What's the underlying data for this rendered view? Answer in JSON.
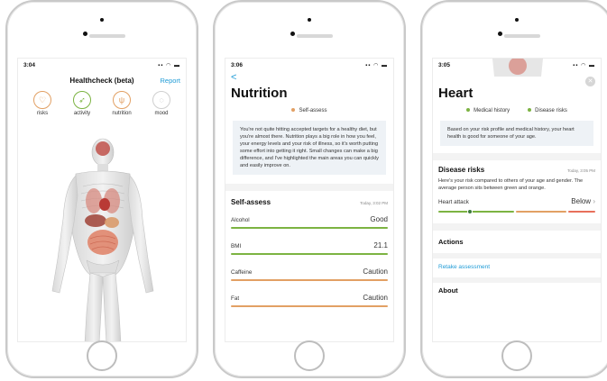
{
  "colors": {
    "accent": "#1f9bd6",
    "good": "#7cb342",
    "caution": "#e2a064",
    "risk": "#e8705b"
  },
  "phone1": {
    "status_time": "3:04",
    "title": "Healthcheck (beta)",
    "report_label": "Report",
    "categories": [
      {
        "label": "risks",
        "icon": "heart-icon"
      },
      {
        "label": "activity",
        "icon": "running-icon"
      },
      {
        "label": "nutrition",
        "icon": "cutlery-icon"
      },
      {
        "label": "mood",
        "icon": "chat-icon"
      }
    ]
  },
  "phone2": {
    "status_time": "3:06",
    "back_label": "<",
    "title": "Nutrition",
    "tag": "Self-assess",
    "summary": "You're not quite hitting accepted targets for a healthy diet, but you're almost there. Nutrition plays a big role in how you feel, your energy levels and your risk of illness, so it's worth putting some effort into getting it right. Small changes can make a big difference, and I've highlighted the main areas you can quickly and easily improve on.",
    "section_title": "Self-assess",
    "section_time": "Today, 3:02 PM",
    "metrics": [
      {
        "name": "Alcohol",
        "value": "Good",
        "status": "good"
      },
      {
        "name": "BMI",
        "value": "21.1",
        "status": "good"
      },
      {
        "name": "Caffeine",
        "value": "Caution",
        "status": "caution"
      },
      {
        "name": "Fat",
        "value": "Caution",
        "status": "caution"
      }
    ]
  },
  "phone3": {
    "status_time": "3:05",
    "title": "Heart",
    "tags": [
      "Medical history",
      "Disease risks"
    ],
    "summary": "Based on your risk profile and medical history, your heart health is good for someone of your age.",
    "risks_title": "Disease risks",
    "risks_time": "Today, 3:05 PM",
    "risks_text": "Here's your risk compared to others of your age and gender. The average person sits between green and orange.",
    "heart_attack_label": "Heart attack",
    "heart_attack_value": "Below",
    "actions_title": "Actions",
    "retake_label": "Retake assessment",
    "about_title": "About"
  }
}
